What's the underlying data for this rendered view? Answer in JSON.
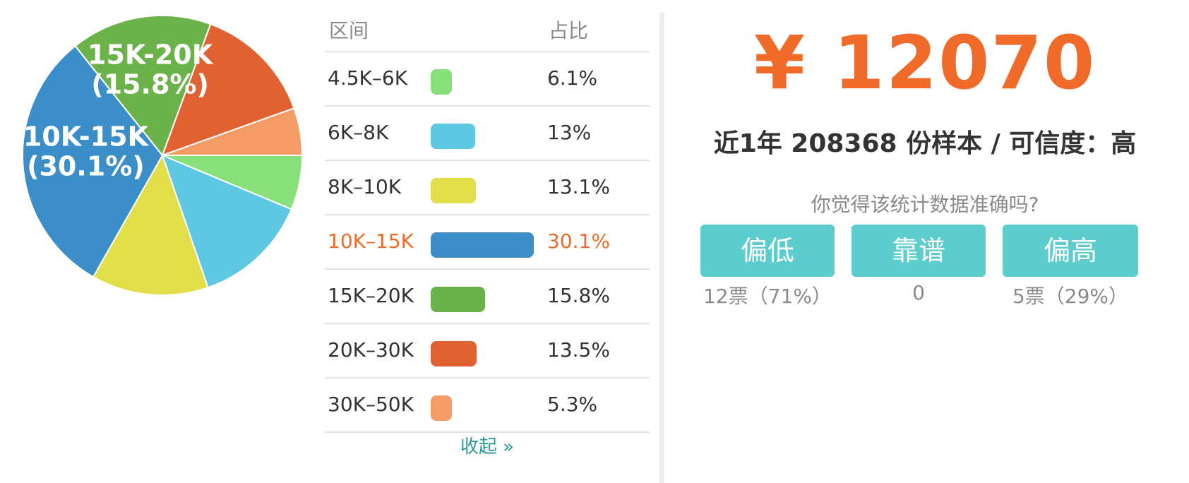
{
  "chart_data": {
    "type": "pie",
    "categories": [
      "4.5K–6K",
      "6K–8K",
      "8K–10K",
      "10K–15K",
      "15K–20K",
      "20K–30K",
      "30K–50K"
    ],
    "values": [
      6.1,
      13,
      13.1,
      30.1,
      15.8,
      13.5,
      5.3
    ],
    "colors": [
      "#88e07a",
      "#5ec8e2",
      "#e2de4a",
      "#3b8ec8",
      "#6cb24a",
      "#e06232",
      "#f59c66"
    ],
    "slice_labels": [
      {
        "category": "10K–15K",
        "line1": "10K-15K",
        "line2": "(30.1%)"
      },
      {
        "category": "15K–20K",
        "line1": "15K-20K",
        "line2": "(15.8%)"
      }
    ],
    "highlight": "10K–15K"
  },
  "table": {
    "header_range": "区间",
    "header_share": "占比",
    "rows": [
      {
        "range": "4.5K–6K",
        "share": "6.1%"
      },
      {
        "range": "6K–8K",
        "share": "13%"
      },
      {
        "range": "8K–10K",
        "share": "13.1%"
      },
      {
        "range": "10K–15K",
        "share": "30.1%"
      },
      {
        "range": "15K–20K",
        "share": "15.8%"
      },
      {
        "range": "20K–30K",
        "share": "13.5%"
      },
      {
        "range": "30K–50K",
        "share": "5.3%"
      }
    ],
    "collapse_label": "收起 »"
  },
  "stats": {
    "salary": "¥ 12070",
    "summary": "近1年 208368 份样本 / 可信度：高",
    "question": "你觉得该统计数据准确吗?",
    "buttons": [
      {
        "label": "偏低",
        "count": "12票（71%）"
      },
      {
        "label": "靠谱",
        "count": "0"
      },
      {
        "label": "偏高",
        "count": "5票（29%）"
      }
    ]
  },
  "colors": {
    "accent": "#f06b2a",
    "button": "#5ccccc",
    "link": "#2a9a98"
  }
}
